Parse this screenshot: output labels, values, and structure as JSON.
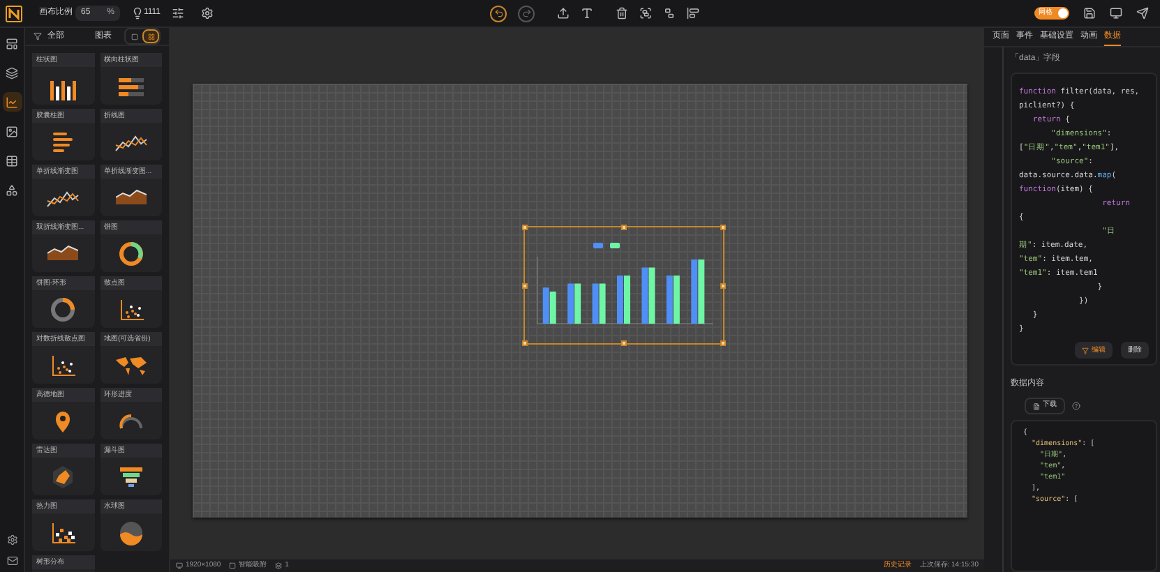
{
  "toolbar": {
    "scale_label": "画布比例",
    "scale_value": "65",
    "scale_unit": "%",
    "bulb_count": "1111",
    "grid_toggle": {
      "label": "网格",
      "on": true
    }
  },
  "sidebar_rail": [
    {
      "selected": false
    },
    {
      "selected": false
    },
    {
      "selected": true
    },
    {
      "selected": false
    },
    {
      "selected": false
    },
    {
      "selected": false
    }
  ],
  "component_panel": {
    "filter_label": "全部",
    "title": "图表",
    "view_modes": [
      {
        "selected": false
      },
      {
        "selected": true
      }
    ],
    "items": [
      "柱状图",
      "横向柱状图",
      "胶囊柱图",
      "折线图",
      "单折线渐变图",
      "单折线渐变图...",
      "双折线渐变图...",
      "饼图",
      "饼图-环形",
      "散点图",
      "对数折线散点图",
      "地图(可选省份)",
      "高德地图",
      "环形进度",
      "雷达图",
      "漏斗图",
      "热力图",
      "水球图",
      "树形分布"
    ]
  },
  "canvas": {
    "chart": {
      "selected": true
    }
  },
  "status_bar": {
    "resolution": "1920×1080",
    "snap": "智能吸附",
    "layers": "1",
    "history": "历史记录",
    "last_saved": "上次保存: 14:15:30"
  },
  "properties": {
    "tabs": [
      {
        "label": "页面",
        "selected": false
      },
      {
        "label": "事件",
        "selected": false
      },
      {
        "label": "基础设置",
        "selected": false
      },
      {
        "label": "动画",
        "selected": false
      },
      {
        "label": "数据",
        "selected": true
      }
    ],
    "data_field_label": "「data」字段",
    "code_lines": [
      [
        {
          "kind": "keyword",
          "text": "function"
        },
        {
          "kind": "plain",
          "text": " filter(data, res,"
        }
      ],
      [
        {
          "kind": "plain",
          "text": "piclient?) {"
        }
      ],
      [
        {
          "kind": "keyword",
          "text": "   return"
        },
        {
          "kind": "plain",
          "text": " {"
        }
      ],
      [
        {
          "kind": "string",
          "text": "       \"dimensions\""
        },
        {
          "kind": "plain",
          "text": ":"
        }
      ],
      [
        {
          "kind": "plain",
          "text": "["
        },
        {
          "kind": "string",
          "text": "\"日期\""
        },
        {
          "kind": "plain",
          "text": ","
        },
        {
          "kind": "string",
          "text": "\"tem\""
        },
        {
          "kind": "plain",
          "text": ","
        },
        {
          "kind": "string",
          "text": "\"tem1\""
        },
        {
          "kind": "plain",
          "text": "],"
        }
      ],
      [
        {
          "kind": "string",
          "text": "       \"source\""
        },
        {
          "kind": "plain",
          "text": ":"
        }
      ],
      [
        {
          "kind": "plain",
          "text": "data.source.data."
        },
        {
          "kind": "method",
          "text": "map"
        },
        {
          "kind": "plain",
          "text": "("
        }
      ],
      [
        {
          "kind": "keyword",
          "text": "function"
        },
        {
          "kind": "plain",
          "text": "(item) {"
        }
      ],
      [
        {
          "kind": "keyword",
          "text": "                  return"
        }
      ],
      [
        {
          "kind": "plain",
          "text": "{"
        }
      ],
      [
        {
          "kind": "string",
          "text": "                  \"日"
        }
      ],
      [
        {
          "kind": "string",
          "text": "期\""
        },
        {
          "kind": "plain",
          "text": ": item.date,"
        }
      ],
      [
        {
          "kind": "string",
          "text": "\"tem\""
        },
        {
          "kind": "plain",
          "text": ": item.tem,"
        }
      ],
      [
        {
          "kind": "string",
          "text": "\"tem1\""
        },
        {
          "kind": "plain",
          "text": ": item.tem1"
        }
      ],
      [
        {
          "kind": "plain",
          "text": "                 }"
        }
      ],
      [
        {
          "kind": "plain",
          "text": "             })"
        }
      ],
      [
        {
          "kind": "plain",
          "text": "   }"
        }
      ],
      [
        {
          "kind": "plain",
          "text": "}"
        }
      ]
    ],
    "edit_button": "编辑",
    "delete_button": "删除",
    "content_label": "数据内容",
    "download_button": "下载",
    "preview_lines": [
      [
        {
          "kind": "plain",
          "text": "{"
        }
      ],
      [
        {
          "kind": "key",
          "text": "  \"dimensions\""
        },
        {
          "kind": "plain",
          "text": ": ["
        }
      ],
      [
        {
          "kind": "string",
          "text": "    \"日期\""
        },
        {
          "kind": "plain",
          "text": ","
        }
      ],
      [
        {
          "kind": "string",
          "text": "    \"tem\""
        },
        {
          "kind": "plain",
          "text": ","
        }
      ],
      [
        {
          "kind": "string",
          "text": "    \"tem1\""
        }
      ],
      [
        {
          "kind": "plain",
          "text": "  ],"
        }
      ],
      [
        {
          "kind": "key",
          "text": "  \"source\""
        },
        {
          "kind": "plain",
          "text": ": ["
        }
      ]
    ]
  }
}
